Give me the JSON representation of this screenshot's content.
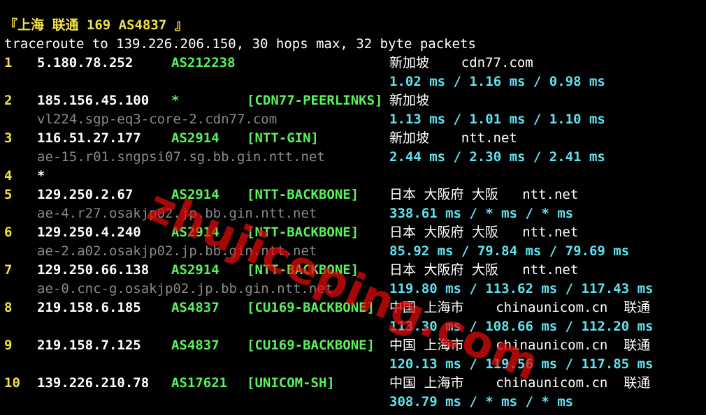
{
  "colors": {
    "background": "#000000",
    "hop_number": "#f2e244",
    "ip": "#ffffff",
    "asn": "#5bf15b",
    "tag": "#5bf15b",
    "location": "#ffffff",
    "hostname": "#8a8a8a",
    "latency": "#5fe3f0",
    "header": "#f2e244",
    "watermark": "#e60a0a"
  },
  "header": "『上海 联通 169 AS4837 』",
  "command": "traceroute to 139.226.206.150, 30 hops max, 32 byte packets",
  "watermark": "zhujiceping.com",
  "hops": [
    {
      "num": "1",
      "ip": "5.180.78.252",
      "asn": "AS212238",
      "tag": "",
      "location": "新加坡    cdn77.com",
      "hostname": "",
      "latency": "1.02 ms / 1.16 ms / 0.98 ms"
    },
    {
      "num": "2",
      "ip": "185.156.45.100",
      "asn": "*",
      "tag": "[CDN77-PEERLINKS]",
      "location": "新加坡",
      "hostname": "vl224.sgp-eq3-core-2.cdn77.com",
      "latency": "1.13 ms / 1.01 ms / 1.10 ms"
    },
    {
      "num": "3",
      "ip": "116.51.27.177",
      "asn": "AS2914",
      "tag": "[NTT-GIN]",
      "location": "新加坡    ntt.net",
      "hostname": "ae-15.r01.sngpsi07.sg.bb.gin.ntt.net",
      "latency": "2.44 ms / 2.30 ms / 2.41 ms"
    },
    {
      "num": "4",
      "ip": "*",
      "asn": "",
      "tag": "",
      "location": "",
      "hostname": "",
      "latency": ""
    },
    {
      "num": "5",
      "ip": "129.250.2.67",
      "asn": "AS2914",
      "tag": "[NTT-BACKBONE]",
      "location": "日本 大阪府 大阪   ntt.net",
      "hostname": "ae-4.r27.osakjp02.jp.bb.gin.ntt.net",
      "latency": "338.61 ms / * ms / * ms"
    },
    {
      "num": "6",
      "ip": "129.250.4.240",
      "asn": "AS2914",
      "tag": "[NTT-BACKBONE]",
      "location": "日本 大阪府 大阪   ntt.net",
      "hostname": "ae-2.a02.osakjp02.jp.bb.gin.ntt.net",
      "latency": "85.92 ms / 79.84 ms / 79.69 ms"
    },
    {
      "num": "7",
      "ip": "129.250.66.138",
      "asn": "AS2914",
      "tag": "[NTT-BACKBONE]",
      "location": "日本 大阪府 大阪   ntt.net",
      "hostname": "ae-0.cnc-g.osakjp02.jp.bb.gin.ntt.net",
      "latency": "119.80 ms / 113.62 ms / 117.43 ms"
    },
    {
      "num": "8",
      "ip": "219.158.6.185",
      "asn": "AS4837",
      "tag": "[CU169-BACKBONE]",
      "location": "中国 上海市    chinaunicom.cn  联通",
      "hostname": "",
      "latency": "113.30 ms / 108.66 ms / 112.20 ms"
    },
    {
      "num": "9",
      "ip": "219.158.7.125",
      "asn": "AS4837",
      "tag": "[CU169-BACKBONE]",
      "location": "中国 上海市    chinaunicom.cn  联通",
      "hostname": "",
      "latency": "120.13 ms / 119.56 ms / 117.85 ms"
    },
    {
      "num": "10",
      "ip": "139.226.210.78",
      "asn": "AS17621",
      "tag": "[UNICOM-SH]",
      "location": "中国 上海市    chinaunicom.cn  联通",
      "hostname": "",
      "latency": "308.79 ms / * ms / * ms"
    }
  ]
}
